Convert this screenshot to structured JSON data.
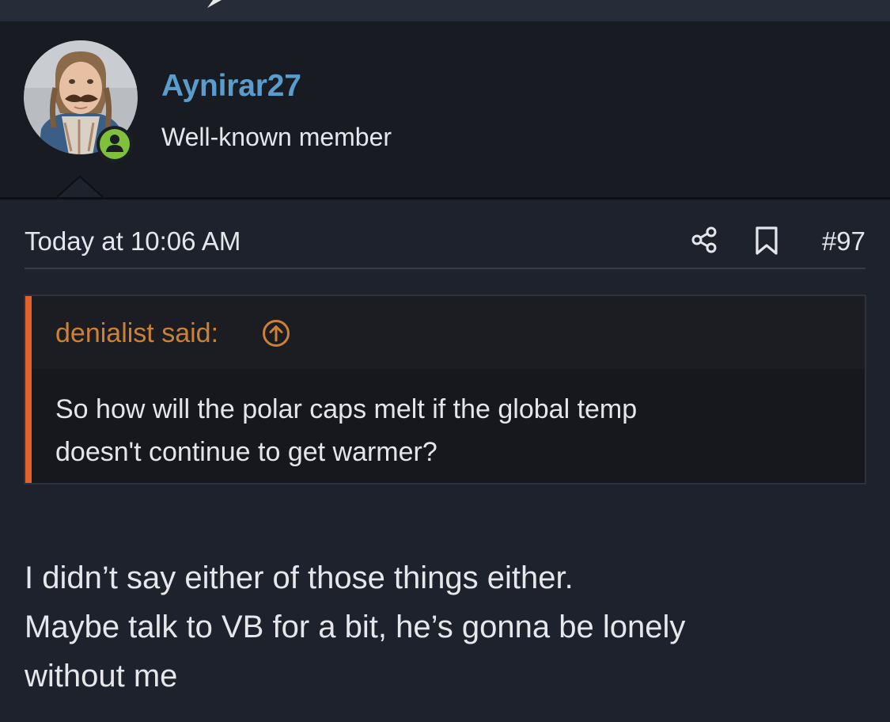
{
  "post": {
    "author": {
      "username": "Aynirar27",
      "title": "Well-known member",
      "avatar_icon": "profile-photo",
      "online_badge_icon": "user-online-icon",
      "online_color": "#7fc13a"
    },
    "meta": {
      "timestamp": "Today at 10:06 AM",
      "share_icon": "share-icon",
      "bookmark_icon": "bookmark-icon",
      "post_number": "#97"
    },
    "quote": {
      "author_label": "denialist said:",
      "jump_icon": "arrow-up-circle-icon",
      "text": "So how will the polar caps melt if the global temp\ndoesn't continue to get warmer?",
      "accent_color": "#e2612c",
      "author_color": "#cc8134"
    },
    "body": "I didn’t say either of those things either.\nMaybe talk to VB for a bit, he’s gonna be lonely\nwithout me"
  },
  "colors": {
    "background": "#1e222c",
    "header_background": "#181b22",
    "username": "#5a9ccc",
    "text": "#e4e6ea"
  }
}
